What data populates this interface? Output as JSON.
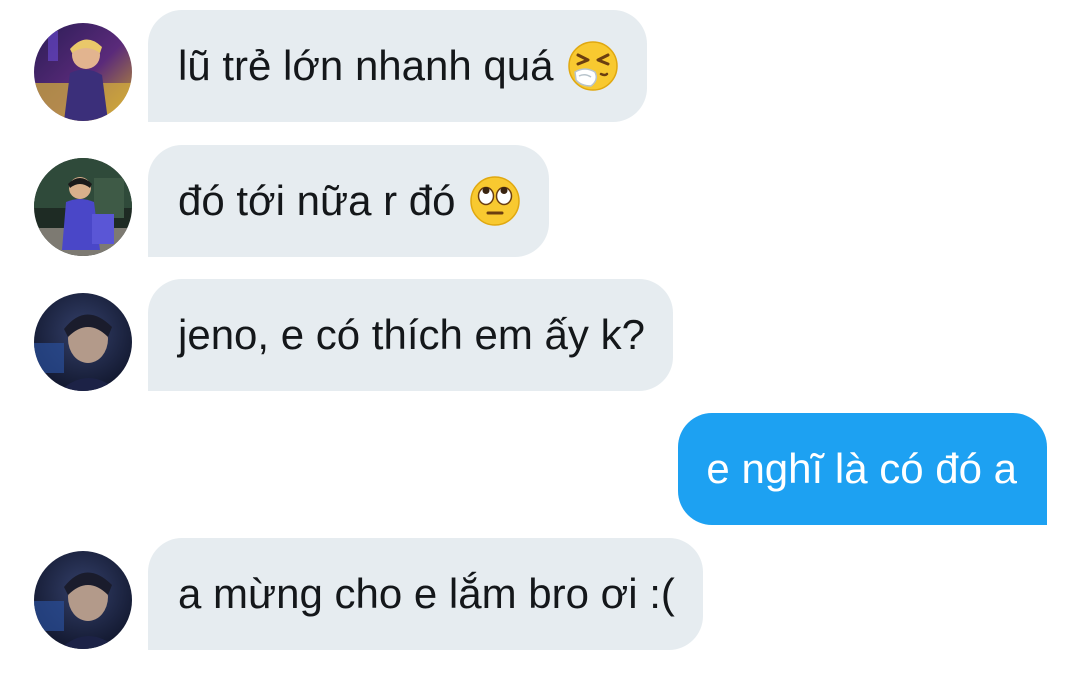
{
  "conversation": {
    "messages": [
      {
        "direction": "incoming",
        "text": "lũ trẻ lớn nhanh quá",
        "emoji": "sneezing-face-icon",
        "avatar": "avatar-neon-stage"
      },
      {
        "direction": "incoming",
        "text": "đó tới nữa r đó",
        "emoji": "rolling-eyes-icon",
        "avatar": "avatar-purple-outfit"
      },
      {
        "direction": "incoming",
        "text": "jeno, e có thích em ấy k?",
        "emoji": "",
        "avatar": "avatar-dark-portrait"
      },
      {
        "direction": "outgoing",
        "text": "e nghĩ là có đó a",
        "emoji": ""
      },
      {
        "direction": "incoming",
        "text": "a mừng cho e lắm bro ơi :(",
        "emoji": "",
        "avatar": "avatar-dark-portrait"
      }
    ]
  },
  "colors": {
    "incoming_bubble": "#e6ecf0",
    "incoming_text": "#14171a",
    "outgoing_bubble": "#1da1f2",
    "outgoing_text": "#ffffff",
    "background": "#ffffff"
  }
}
